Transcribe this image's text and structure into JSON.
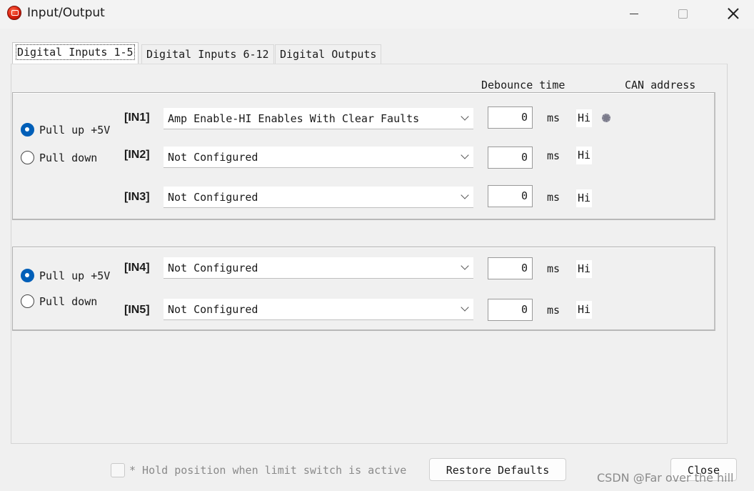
{
  "window": {
    "title": "Input/Output"
  },
  "tabs": [
    {
      "label": "Digital Inputs 1-5"
    },
    {
      "label": "Digital Inputs 6-12"
    },
    {
      "label": "Digital Outputs"
    }
  ],
  "headers": {
    "debounce": "Debounce time",
    "can_address": "CAN address"
  },
  "group1": {
    "pull_up": "Pull up +5V",
    "pull_down": "Pull down",
    "pull_up_selected": true,
    "inputs": [
      {
        "label": "[IN1]",
        "function": "Amp Enable-HI Enables With Clear Faults",
        "debounce": "0",
        "unit": "ms",
        "level": "Hi"
      },
      {
        "label": "[IN2]",
        "function": "Not Configured",
        "debounce": "0",
        "unit": "ms",
        "level": "Hi"
      },
      {
        "label": "[IN3]",
        "function": "Not Configured",
        "debounce": "0",
        "unit": "ms",
        "level": "Hi"
      }
    ]
  },
  "group2": {
    "pull_up": "Pull up +5V",
    "pull_down": "Pull down",
    "pull_up_selected": true,
    "inputs": [
      {
        "label": "[IN4]",
        "function": "Not Configured",
        "debounce": "0",
        "unit": "ms",
        "level": "Hi"
      },
      {
        "label": "[IN5]",
        "function": "Not Configured",
        "debounce": "0",
        "unit": "ms",
        "level": "Hi"
      }
    ]
  },
  "footer": {
    "hold_label": "* Hold position when limit switch is active",
    "restore_button": "Restore Defaults",
    "close_button": "Close"
  },
  "watermark": "CSDN @Far over the hill",
  "colors": {
    "accent": "#005fb8",
    "background": "#f0f0f0"
  },
  "icons": {
    "app": "app-logo-icon",
    "status": "gear-icon"
  }
}
